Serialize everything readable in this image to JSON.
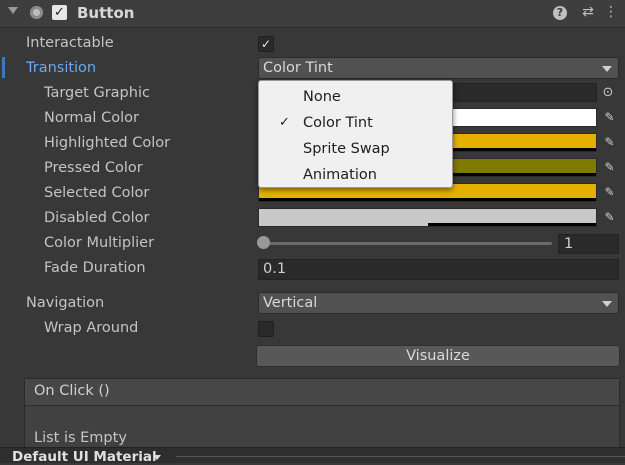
{
  "header": {
    "title": "Button",
    "enabled_check": "✓"
  },
  "icons": {
    "help": "?",
    "presets": "⇄",
    "more": "⋮"
  },
  "props": {
    "interactable": {
      "label": "Interactable",
      "check": "✓"
    },
    "transition": {
      "label": "Transition",
      "value": "Color Tint"
    },
    "target_graphic": {
      "label": "Target Graphic"
    },
    "normal_color": {
      "label": "Normal Color",
      "color": "#ffffff"
    },
    "highlighted_color": {
      "label": "Highlighted Color",
      "color": "#e5b100"
    },
    "pressed_color": {
      "label": "Pressed Color",
      "color": "#7f7a00"
    },
    "selected_color": {
      "label": "Selected Color",
      "color": "#e5b100"
    },
    "disabled_color": {
      "label": "Disabled Color",
      "color": "#c8c8c8"
    },
    "color_multiplier": {
      "label": "Color Multiplier",
      "value": "1"
    },
    "fade_duration": {
      "label": "Fade Duration",
      "value": "0.1"
    },
    "navigation": {
      "label": "Navigation",
      "value": "Vertical"
    },
    "wrap_around": {
      "label": "Wrap Around"
    }
  },
  "visualize_label": "Visualize",
  "on_click": {
    "title": "On Click ()",
    "empty_text": "List is Empty"
  },
  "footer": {
    "material_label": "Default UI Material"
  },
  "popup": {
    "items": [
      {
        "label": "None",
        "checked": ""
      },
      {
        "label": "Color Tint",
        "checked": "✓"
      },
      {
        "label": "Sprite Swap",
        "checked": ""
      },
      {
        "label": "Animation",
        "checked": ""
      }
    ]
  }
}
